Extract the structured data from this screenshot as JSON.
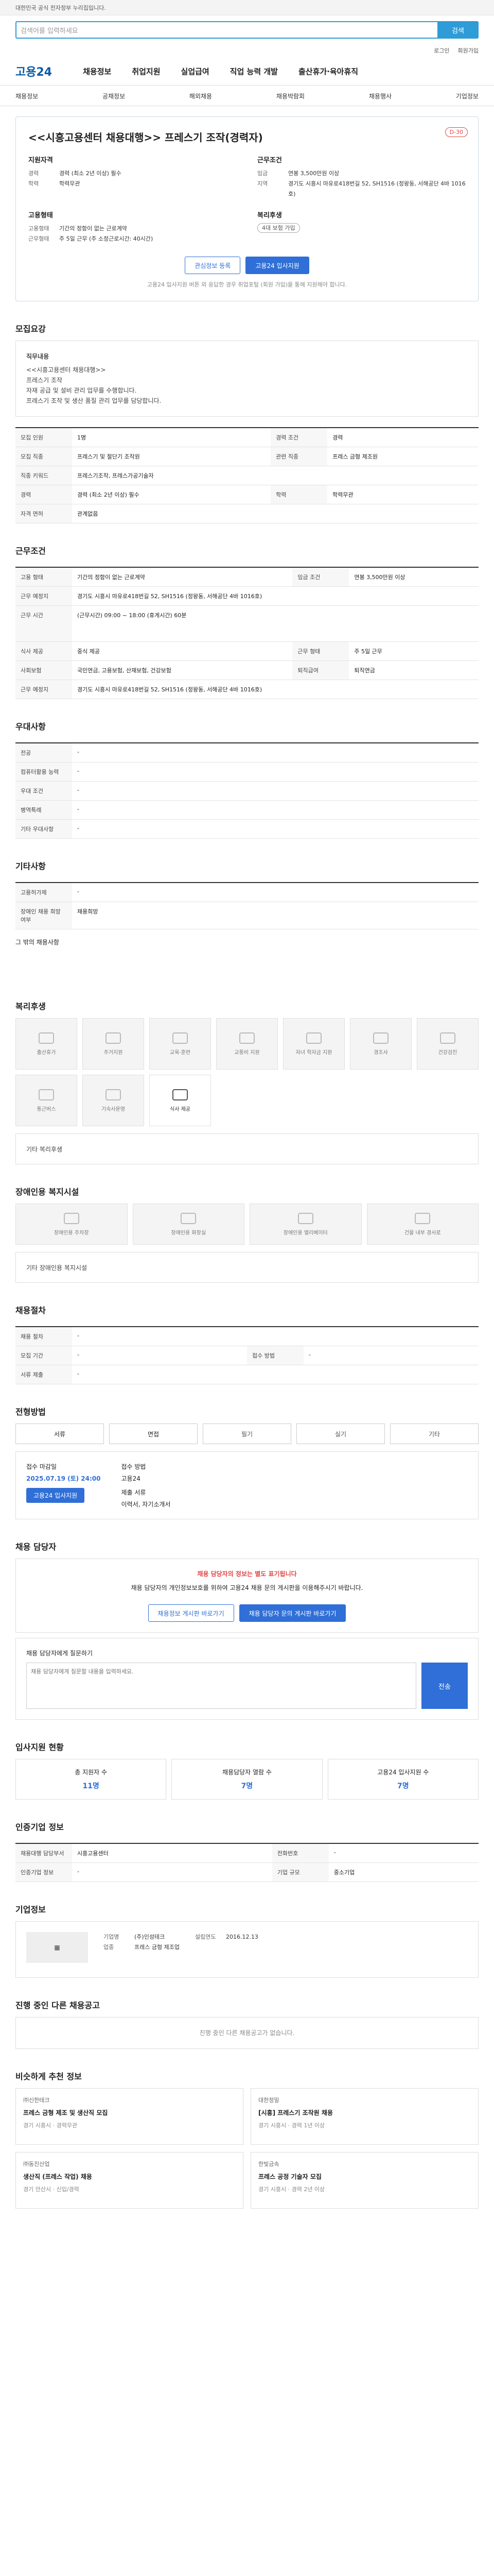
{
  "topbar": {
    "notice": "대한민국 공식 전자정부 누리집입니다."
  },
  "search": {
    "placeholder": "검색어를 입력하세요",
    "button": "검색"
  },
  "util": {
    "login": "로그인",
    "join": "회원가입"
  },
  "gnb": {
    "logo": "고용24",
    "items": [
      "채용정보",
      "취업지원",
      "실업급여",
      "직업 능력 개발",
      "출산휴가·육아휴직"
    ]
  },
  "subnav": [
    "채용정보",
    "공채정보",
    "해외채용",
    "채용박람회",
    "채용행사",
    "기업정보"
  ],
  "job": {
    "title": "<<시흥고용센터 채용대행>> 프레스기 조작(경력자)",
    "dday": "D-30",
    "qual_head": "지원자격",
    "qual": [
      {
        "k": "경력",
        "v": "경력 (최소 2년 이상) 필수"
      },
      {
        "k": "학력",
        "v": "학력무관"
      }
    ],
    "cond_head": "근무조건",
    "cond": [
      {
        "k": "임금",
        "v": "연봉 3,500만원 이상"
      },
      {
        "k": "지역",
        "v": "경기도 시흥시 마유로418번길 52, SH1516 (정왕동, 서해공단 4바 1016호)"
      }
    ],
    "emp_head": "고용형태",
    "emp": [
      {
        "k": "고용형태",
        "v": "기간의 정함이 없는 근로계약"
      },
      {
        "k": "근무형태",
        "v": "주 5일 근무 (주 소정근로시간: 40시간)"
      }
    ],
    "welfare_head": "복리후생",
    "welfare_tag": "4대 보험 가입",
    "btn_scrap": "관심정보 등록",
    "btn_apply": "고용24 입사지원",
    "note": "고용24 입사지원 버튼 외 응답한 경우 취업포털 (회원 가입)을 통해 지원해야 합니다."
  },
  "sec": {
    "info": "모집요강",
    "cond": "근무조건",
    "pref": "우대사항",
    "etc": "기타사항",
    "welfare": "복리후생",
    "dis": "장애인용 복지시설",
    "proc": "채용절차",
    "apply": "전형방법",
    "qna": "채용 담당자",
    "stat": "입사지원 현황",
    "mgr": "인증기업 정보",
    "co": "기업정보",
    "others": "진행 중인 다른 채용공고",
    "recs": "비슷하게 추천 정보"
  },
  "desc": {
    "head": "직무내용",
    "lines": [
      "<<시흥고용센터 채용대행>>",
      "프레스기 조작",
      "자재 공급 및 설비 관리 업무를 수행합니다.",
      "프레스기 조작 및 생산 품질 관리 업무를 담당합니다."
    ]
  },
  "info_rows": [
    {
      "k": "모집 인원",
      "v": "1명",
      "k2": "경력 조건",
      "v2": "경력"
    },
    {
      "k": "모집 직종",
      "v": "프레스기 및 절단기 조작원",
      "k2": "관련 직종",
      "v2": "프레스 금형 제조원"
    },
    {
      "k": "직종 키워드",
      "v": "프레스기조작, 프레스가공기술자",
      "k2": "",
      "v2": ""
    },
    {
      "k": "경력",
      "v": "경력 (최소 2년 이상) 필수",
      "k2": "학력",
      "v2": "학력무관"
    },
    {
      "k": "자격 면허",
      "v": "관계없음",
      "k2": "",
      "v2": ""
    }
  ],
  "cond_rows": [
    {
      "k": "고용 형태",
      "v": "기간의 정함이 없는 근로계약",
      "k2": "임금 조건",
      "v2": "연봉 3,500만원 이상"
    },
    {
      "k": "근무 예정지",
      "v": "경기도 시흥시 마유로418번길 52, SH1516 (정왕동, 서해공단 4바 1016호)",
      "k2": "",
      "v2": ""
    },
    {
      "k": "근무 시간",
      "v": "(근무시간) 09:00 ~ 18:00 (휴게시간) 60분",
      "k2": "",
      "v2": ""
    },
    {
      "k": "식사 제공",
      "v": "중식 제공",
      "k2": "근무 형태",
      "v2": "주 5일 근무"
    },
    {
      "k": "사회보험",
      "v": "국민연금, 고용보험, 산재보험, 건강보험",
      "k2": "퇴직급여",
      "v2": "퇴직연금"
    },
    {
      "k": "근무 예정지",
      "v": "경기도 시흥시 마유로418번길 52, SH1516 (정왕동, 서해공단 4바 1016호)",
      "k2": "",
      "v2": ""
    }
  ],
  "pref_rows": [
    {
      "k": "전공",
      "v": "-"
    },
    {
      "k": "컴퓨터활용 능력",
      "v": "-"
    },
    {
      "k": "우대 조건",
      "v": "-"
    },
    {
      "k": "병역특례",
      "v": "-"
    },
    {
      "k": "기타 우대사항",
      "v": "-"
    }
  ],
  "etc_rows": [
    {
      "k": "고용허가제",
      "v": "-"
    },
    {
      "k": "장애인 채용 희망 여부",
      "v": "채용희망"
    }
  ],
  "etc_extra": "그 밖의 채용사항",
  "welfare_items": [
    "출산휴가",
    "주거지원",
    "교육·훈련",
    "교통비 지원",
    "자녀 학자금 지원",
    "경조사",
    "건강검진",
    "통근버스",
    "기숙사운영",
    "식사 제공"
  ],
  "welfare_note": "기타 복리후생",
  "dis_items": [
    "장애인용 주차장",
    "장애인용 화장실",
    "장애인용 엘리베이터",
    "건물 내부 경사로"
  ],
  "dis_note": "기타 장애인용 복지시설",
  "proc_rows": [
    {
      "k": "채용 절차",
      "v": "-",
      "k2": "",
      "v2": ""
    },
    {
      "k": "모집 기간",
      "v": "-",
      "k2": "접수 방법",
      "v2": "-"
    },
    {
      "k": "서류 제출",
      "v": "-",
      "k2": "",
      "v2": ""
    }
  ],
  "steps": [
    "서류",
    "면접",
    "필기",
    "실기",
    "기타"
  ],
  "apply_info": {
    "k1": "접수 마감일",
    "v1": "2025.07.19 (토) 24:00",
    "k2": "접수 방법",
    "v2": "고용24",
    "btn": "고용24 입사지원",
    "k3": "제출 서류",
    "v3": "이력서, 자기소개서"
  },
  "warn": {
    "red": "채용 담당자의 정보는 별도 표기됩니다",
    "text": "채용 담당자의 개인정보보호를 위하여 고용24 채용 문의 게시판을 이용해주시기 바랍니다.",
    "b1": "채용정보 게시판 바로가기",
    "b2": "채용 담당자 문의 게시판 바로가기"
  },
  "qna": {
    "label": "채용 담당자에게 질문하기",
    "placeholder": "채용 담당자에게 질문할 내용을 입력하세요.",
    "button": "전송"
  },
  "stats": [
    {
      "k": "총 지원자 수",
      "v": "11명"
    },
    {
      "k": "채용담당자 열람 수",
      "v": "7명"
    },
    {
      "k": "고용24 입사지원 수",
      "v": "7명"
    }
  ],
  "mgr_rows": [
    {
      "k": "채용대행 담당부서",
      "v": "시흥고용센터",
      "k2": "전화번호",
      "v2": "-"
    },
    {
      "k": "인증기업 정보",
      "v": "-",
      "k2": "기업 규모",
      "v2": "중소기업"
    }
  ],
  "co": {
    "k1": "기업명",
    "v1": "(주)인성테크",
    "k2": "업종",
    "v2": "프레스 금형 제조업",
    "k3": "설립연도",
    "v3": "2016.12.13"
  },
  "others_note": "진행 중인 다른 채용공고가 없습니다.",
  "recs": [
    {
      "co": "㈜신한테크",
      "t": "프레스 금형 제조 및 생산직 모집",
      "d": "경기 시흥시 · 경력무관"
    },
    {
      "co": "대한정밀",
      "t": "[시흥] 프레스기 조작원 채용",
      "d": "경기 시흥시 · 경력 1년 이상"
    },
    {
      "co": "㈜동진산업",
      "t": "생산직 (프레스 작업) 채용",
      "d": "경기 안산시 · 신입/경력"
    },
    {
      "co": "한빛금속",
      "t": "프레스 공정 기술자 모집",
      "d": "경기 시흥시 · 경력 2년 이상"
    }
  ]
}
